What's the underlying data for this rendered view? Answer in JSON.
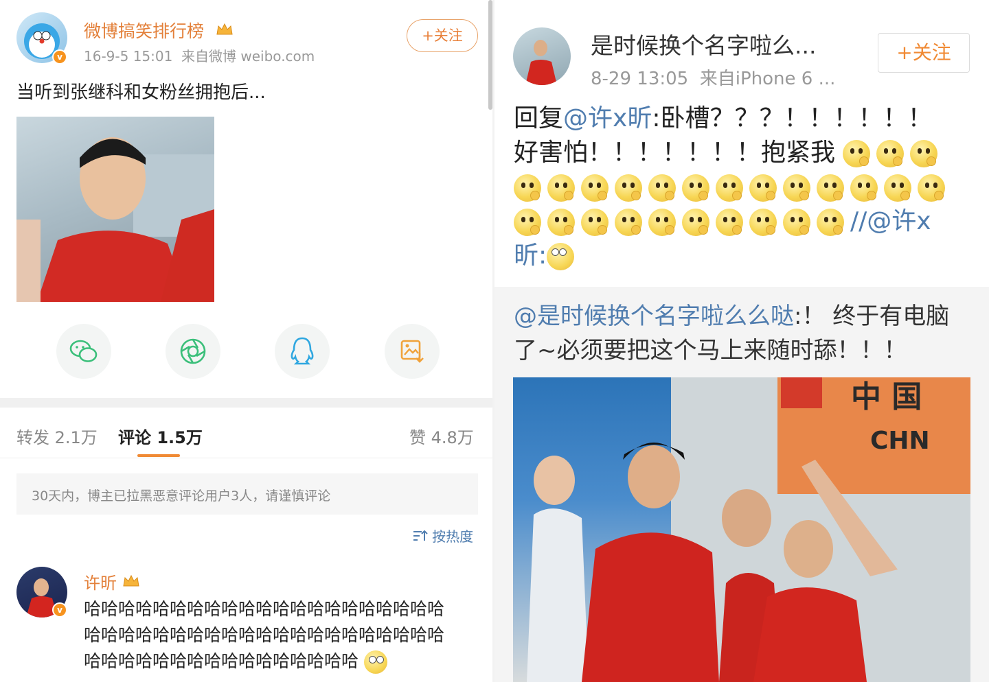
{
  "left_post": {
    "author": "微博搞笑排行榜",
    "meta": "16-9-5 15:01  来自微博 weibo.com",
    "follow_label": "+关注",
    "text": "当听到张继科和女粉丝拥抱后...",
    "share_icons": [
      "wechat-icon",
      "moments-icon",
      "qq-icon",
      "save-image-icon"
    ]
  },
  "tabs": {
    "repost": "转发 2.1万",
    "comment": "评论 1.5万",
    "like": "赞 4.8万"
  },
  "notice": "30天内，博主已拉黑恶意评论用户3人，请谨慎评论",
  "sort_label": "按热度",
  "comment": {
    "author": "许昕",
    "lines": [
      "哈哈哈哈哈哈哈哈哈哈哈哈哈哈哈哈哈哈哈哈哈",
      "哈哈哈哈哈哈哈哈哈哈哈哈哈哈哈哈哈哈哈哈哈",
      "哈哈哈哈哈哈哈哈哈哈哈哈哈哈哈哈"
    ]
  },
  "right_post": {
    "author": "是时候换个名字啦么...",
    "meta": "8-29 13:05  来自iPhone 6 ...",
    "follow_label": "+关注",
    "reply_prefix": "回复",
    "reply_mention": "@许x昕",
    "reply_text": ":卧槽？？？！！！！！！",
    "line2": "好害怕！！！！！！！抱紧我",
    "forward_mention": "//@许x",
    "forward_tail": "昕:",
    "quote_mention": "@是时候换个名字啦么么哒",
    "quote_text1": ":！ 终于有电脑",
    "quote_text2": "了~必须要把这个马上来随时舔！！！",
    "banner_text": "中 国",
    "banner_code": "CHN"
  },
  "colors": {
    "accent": "#f08a34",
    "link": "#507daf",
    "username": "#e3803a"
  }
}
